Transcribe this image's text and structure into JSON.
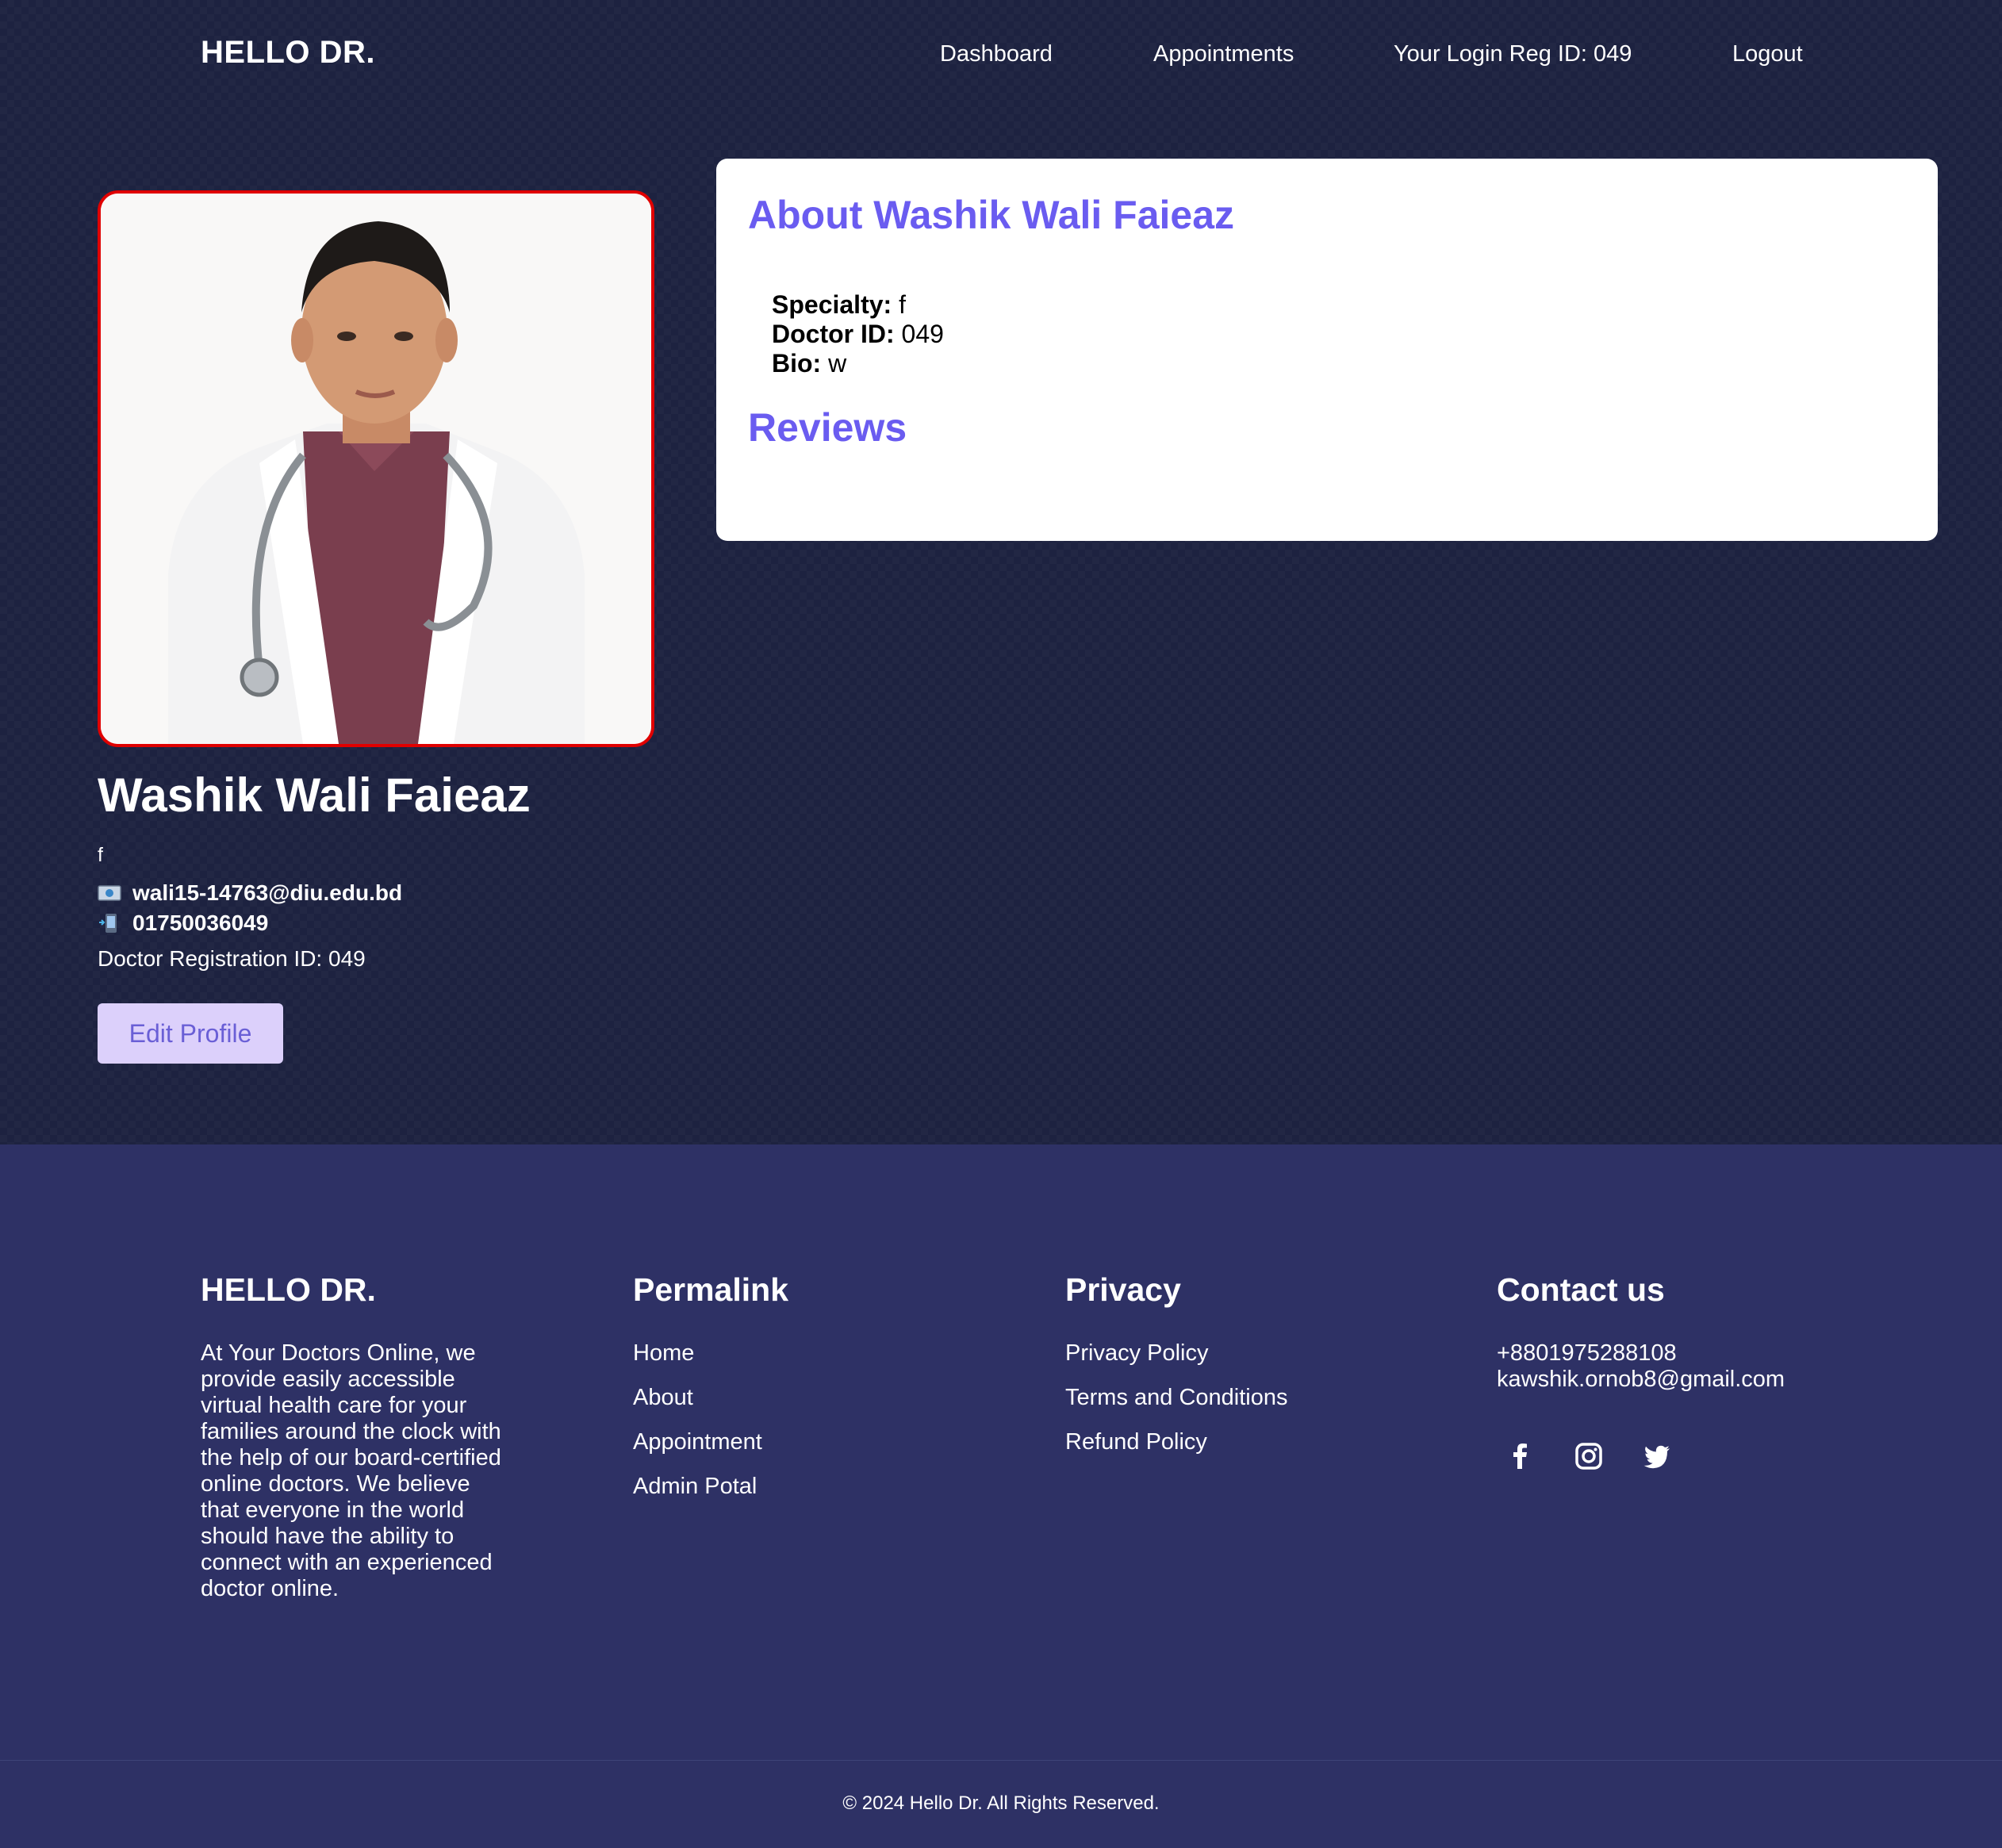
{
  "header": {
    "brand": "HELLO DR.",
    "nav": {
      "dashboard": "Dashboard",
      "appointments": "Appointments",
      "reg_id": "Your Login Reg ID: 049",
      "logout": "Logout"
    }
  },
  "profile": {
    "name": "Washik Wali Faieaz",
    "specialty": "f",
    "email": "wali15-14763@diu.edu.bd",
    "phone": "01750036049",
    "registration": "Doctor Registration ID: 049",
    "edit_button": "Edit Profile"
  },
  "about": {
    "title": "About Washik Wali Faieaz",
    "specialty_label": "Specialty:",
    "specialty_value": "f",
    "doctor_id_label": "Doctor ID:",
    "doctor_id_value": "049",
    "bio_label": "Bio:",
    "bio_value": "w",
    "reviews_title": "Reviews"
  },
  "footer": {
    "brand": {
      "heading": "HELLO DR.",
      "text": "At Your Doctors Online, we provide easily accessible virtual health care for your families around the clock with the help of our board-certified online doctors. We believe that everyone in the world should have the ability to connect with an experienced doctor online."
    },
    "permalink": {
      "heading": "Permalink",
      "links": [
        "Home",
        "About",
        "Appointment",
        "Admin Potal"
      ]
    },
    "privacy": {
      "heading": "Privacy",
      "links": [
        "Privacy Policy",
        "Terms and Conditions",
        "Refund Policy"
      ]
    },
    "contact": {
      "heading": "Contact us",
      "phone": "+8801975288108",
      "email": "kawshik.ornob8@gmail.com"
    },
    "socials": [
      "facebook-icon",
      "instagram-icon",
      "twitter-icon"
    ],
    "copyright": "© 2024 Hello Dr. All Rights Reserved."
  },
  "colors": {
    "page_bg": "#1d2240",
    "footer_bg": "#2e3165",
    "accent": "#6a5cf0",
    "photo_border": "#e00000",
    "button_bg": "#dcd0fb"
  }
}
